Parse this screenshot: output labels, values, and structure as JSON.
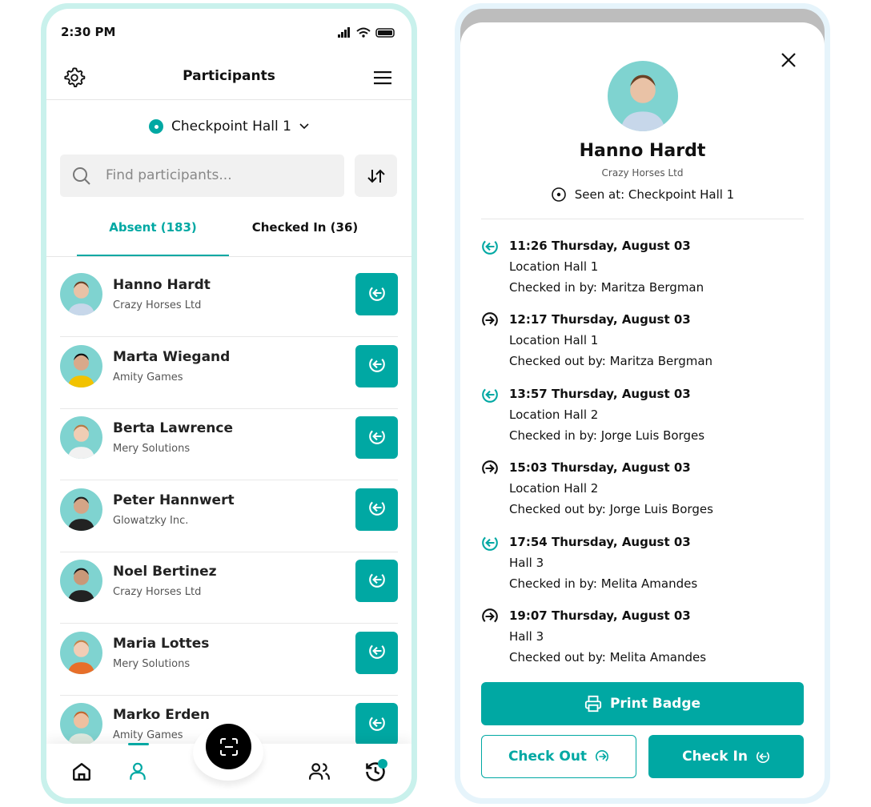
{
  "colors": {
    "accent": "#00a8a3"
  },
  "status_bar": {
    "time": "2:30 PM"
  },
  "left": {
    "title": "Participants",
    "checkpoint": "Checkpoint Hall 1",
    "search_placeholder": "Find participants...",
    "tabs": [
      {
        "label": "Absent (183)",
        "active": true
      },
      {
        "label": "Checked In (36)",
        "active": false
      }
    ],
    "participants": [
      {
        "name": "Hanno Hardt",
        "company": "Crazy Horses Ltd"
      },
      {
        "name": "Marta Wiegand",
        "company": "Amity Games"
      },
      {
        "name": "Berta Lawrence",
        "company": "Mery Solutions"
      },
      {
        "name": "Peter Hannwert",
        "company": "Glowatzky Inc."
      },
      {
        "name": "Noel Bertinez",
        "company": "Crazy Horses Ltd"
      },
      {
        "name": "Maria Lottes",
        "company": "Mery Solutions"
      },
      {
        "name": "Marko Erden",
        "company": "Amity Games"
      }
    ],
    "nav": [
      "home-icon",
      "person-icon",
      "scan-icon",
      "people-icon",
      "history-icon"
    ]
  },
  "detail": {
    "name": "Hanno Hardt",
    "company": "Crazy Horses Ltd",
    "seen_at": "Seen at: Checkpoint Hall 1",
    "events": [
      {
        "type": "in",
        "time": "11:26 Thursday, August 03",
        "location": "Location Hall 1",
        "by": "Checked in by: Maritza Bergman"
      },
      {
        "type": "out",
        "time": "12:17 Thursday, August 03",
        "location": "Location Hall 1",
        "by": "Checked out by: Maritza Bergman"
      },
      {
        "type": "in",
        "time": "13:57 Thursday, August 03",
        "location": "Location Hall 2",
        "by": "Checked in by: Jorge Luis Borges"
      },
      {
        "type": "out",
        "time": "15:03 Thursday, August 03",
        "location": "Location Hall 2",
        "by": "Checked out by: Jorge Luis Borges"
      },
      {
        "type": "in",
        "time": "17:54 Thursday, August 03",
        "location": "Hall 3",
        "by": "Checked in by: Melita Amandes"
      },
      {
        "type": "out",
        "time": "19:07 Thursday, August 03",
        "location": "Hall 3",
        "by": "Checked out by: Melita Amandes"
      }
    ],
    "print_badge": "Print Badge",
    "check_out": "Check Out",
    "check_in": "Check In"
  }
}
